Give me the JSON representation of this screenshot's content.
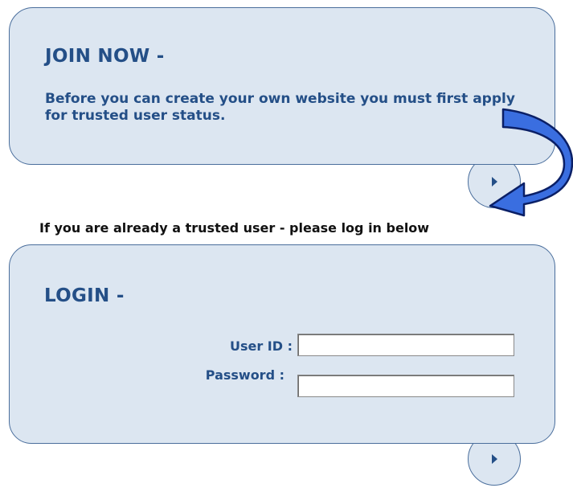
{
  "join": {
    "heading": "JOIN NOW -",
    "body": "Before you can create your own website you must first apply for trusted user status."
  },
  "notice": "If you are already a trusted user - please log in below",
  "login": {
    "heading": "LOGIN -",
    "user_id_label": "User ID :",
    "password_label": "Password :",
    "user_id_value": "",
    "password_value": ""
  },
  "icons": {
    "join_go": "play-arrow-icon",
    "login_go": "play-arrow-icon",
    "pointer": "curved-arrow-icon"
  },
  "colors": {
    "panel_bg": "#dce6f1",
    "panel_border": "#4a6e9c",
    "heading_text": "#244f87",
    "arrow_fill": "#3a6ee0"
  }
}
